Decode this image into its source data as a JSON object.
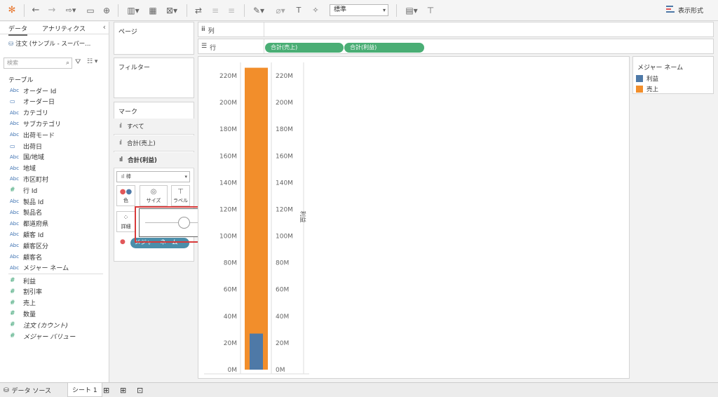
{
  "data_pane": {
    "tabs": [
      "データ",
      "アナリティクス"
    ],
    "datasource": "注文 (サンプル - スーパー...",
    "search_placeholder": "検索",
    "tables_label": "テーブル",
    "dimensions": [
      {
        "type": "Abc",
        "name": "オーダー Id"
      },
      {
        "type": "date",
        "name": "オーダー日"
      },
      {
        "type": "Abc",
        "name": "カテゴリ"
      },
      {
        "type": "Abc",
        "name": "サブカテゴリ"
      },
      {
        "type": "Abc",
        "name": "出荷モード"
      },
      {
        "type": "date",
        "name": "出荷日"
      },
      {
        "type": "Abc",
        "name": "国/地域"
      },
      {
        "type": "Abc",
        "name": "地域"
      },
      {
        "type": "Abc",
        "name": "市区町村"
      },
      {
        "type": "#",
        "name": "行 Id"
      },
      {
        "type": "Abc",
        "name": "製品 Id"
      },
      {
        "type": "Abc",
        "name": "製品名"
      },
      {
        "type": "Abc",
        "name": "都道府県"
      },
      {
        "type": "Abc",
        "name": "顧客 Id"
      },
      {
        "type": "Abc",
        "name": "顧客区分"
      },
      {
        "type": "Abc",
        "name": "顧客名"
      },
      {
        "type": "Abc",
        "name": "メジャー ネーム"
      }
    ],
    "measures": [
      {
        "type": "#",
        "name": "利益"
      },
      {
        "type": "#",
        "name": "割引率"
      },
      {
        "type": "#",
        "name": "売上"
      },
      {
        "type": "#",
        "name": "数量"
      },
      {
        "type": "#",
        "name": "注文 (カウント)",
        "italic": true
      },
      {
        "type": "#",
        "name": "メジャー バリュー",
        "italic": true
      }
    ]
  },
  "toolbar": {
    "fit_select": "標準",
    "show_me": "表示形式"
  },
  "cards": {
    "pages": "ページ",
    "filters": "フィルター",
    "marks": "マーク",
    "marks_rows": [
      "すべて",
      "合計(売上)",
      "合計(利益)"
    ],
    "mark_type": "棒",
    "mark_buttons": {
      "color": "色",
      "size": "サイズ",
      "label": "ラベル",
      "detail": "詳細"
    },
    "color_pill": "メジャー ネーム"
  },
  "shelves": {
    "columns_label": "列",
    "rows_label": "行",
    "rows_pills": [
      "合計(売上)",
      "合計(利益)"
    ]
  },
  "legend": {
    "title": "メジャー ネーム",
    "items": [
      {
        "name": "利益",
        "color": "#4e79a7"
      },
      {
        "name": "売上",
        "color": "#f28e2b"
      }
    ]
  },
  "chart_data": {
    "type": "bar",
    "series": [
      {
        "name": "売上",
        "values": [
          226000000
        ],
        "color": "#f28e2b"
      },
      {
        "name": "利益",
        "values": [
          27000000
        ],
        "color": "#4e79a7"
      }
    ],
    "yticks": [
      "0M",
      "20M",
      "40M",
      "60M",
      "80M",
      "100M",
      "120M",
      "140M",
      "160M",
      "180M",
      "200M",
      "220M"
    ],
    "ylim": [
      0,
      230000000
    ],
    "ylabel": "利益"
  },
  "size_slider": {
    "value": 0.42
  },
  "bottom": {
    "datasource_tab": "データ ソース",
    "sheet_tab": "シート 1"
  }
}
